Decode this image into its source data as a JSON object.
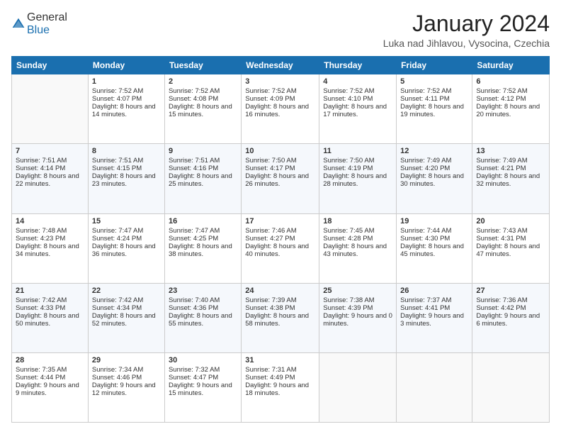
{
  "header": {
    "logo_general": "General",
    "logo_blue": "Blue",
    "month_title": "January 2024",
    "location": "Luka nad Jihlavou, Vysocina, Czechia"
  },
  "weekdays": [
    "Sunday",
    "Monday",
    "Tuesday",
    "Wednesday",
    "Thursday",
    "Friday",
    "Saturday"
  ],
  "weeks": [
    [
      {
        "day": "",
        "sunrise": "",
        "sunset": "",
        "daylight": ""
      },
      {
        "day": "1",
        "sunrise": "Sunrise: 7:52 AM",
        "sunset": "Sunset: 4:07 PM",
        "daylight": "Daylight: 8 hours and 14 minutes."
      },
      {
        "day": "2",
        "sunrise": "Sunrise: 7:52 AM",
        "sunset": "Sunset: 4:08 PM",
        "daylight": "Daylight: 8 hours and 15 minutes."
      },
      {
        "day": "3",
        "sunrise": "Sunrise: 7:52 AM",
        "sunset": "Sunset: 4:09 PM",
        "daylight": "Daylight: 8 hours and 16 minutes."
      },
      {
        "day": "4",
        "sunrise": "Sunrise: 7:52 AM",
        "sunset": "Sunset: 4:10 PM",
        "daylight": "Daylight: 8 hours and 17 minutes."
      },
      {
        "day": "5",
        "sunrise": "Sunrise: 7:52 AM",
        "sunset": "Sunset: 4:11 PM",
        "daylight": "Daylight: 8 hours and 19 minutes."
      },
      {
        "day": "6",
        "sunrise": "Sunrise: 7:52 AM",
        "sunset": "Sunset: 4:12 PM",
        "daylight": "Daylight: 8 hours and 20 minutes."
      }
    ],
    [
      {
        "day": "7",
        "sunrise": "Sunrise: 7:51 AM",
        "sunset": "Sunset: 4:14 PM",
        "daylight": "Daylight: 8 hours and 22 minutes."
      },
      {
        "day": "8",
        "sunrise": "Sunrise: 7:51 AM",
        "sunset": "Sunset: 4:15 PM",
        "daylight": "Daylight: 8 hours and 23 minutes."
      },
      {
        "day": "9",
        "sunrise": "Sunrise: 7:51 AM",
        "sunset": "Sunset: 4:16 PM",
        "daylight": "Daylight: 8 hours and 25 minutes."
      },
      {
        "day": "10",
        "sunrise": "Sunrise: 7:50 AM",
        "sunset": "Sunset: 4:17 PM",
        "daylight": "Daylight: 8 hours and 26 minutes."
      },
      {
        "day": "11",
        "sunrise": "Sunrise: 7:50 AM",
        "sunset": "Sunset: 4:19 PM",
        "daylight": "Daylight: 8 hours and 28 minutes."
      },
      {
        "day": "12",
        "sunrise": "Sunrise: 7:49 AM",
        "sunset": "Sunset: 4:20 PM",
        "daylight": "Daylight: 8 hours and 30 minutes."
      },
      {
        "day": "13",
        "sunrise": "Sunrise: 7:49 AM",
        "sunset": "Sunset: 4:21 PM",
        "daylight": "Daylight: 8 hours and 32 minutes."
      }
    ],
    [
      {
        "day": "14",
        "sunrise": "Sunrise: 7:48 AM",
        "sunset": "Sunset: 4:23 PM",
        "daylight": "Daylight: 8 hours and 34 minutes."
      },
      {
        "day": "15",
        "sunrise": "Sunrise: 7:47 AM",
        "sunset": "Sunset: 4:24 PM",
        "daylight": "Daylight: 8 hours and 36 minutes."
      },
      {
        "day": "16",
        "sunrise": "Sunrise: 7:47 AM",
        "sunset": "Sunset: 4:25 PM",
        "daylight": "Daylight: 8 hours and 38 minutes."
      },
      {
        "day": "17",
        "sunrise": "Sunrise: 7:46 AM",
        "sunset": "Sunset: 4:27 PM",
        "daylight": "Daylight: 8 hours and 40 minutes."
      },
      {
        "day": "18",
        "sunrise": "Sunrise: 7:45 AM",
        "sunset": "Sunset: 4:28 PM",
        "daylight": "Daylight: 8 hours and 43 minutes."
      },
      {
        "day": "19",
        "sunrise": "Sunrise: 7:44 AM",
        "sunset": "Sunset: 4:30 PM",
        "daylight": "Daylight: 8 hours and 45 minutes."
      },
      {
        "day": "20",
        "sunrise": "Sunrise: 7:43 AM",
        "sunset": "Sunset: 4:31 PM",
        "daylight": "Daylight: 8 hours and 47 minutes."
      }
    ],
    [
      {
        "day": "21",
        "sunrise": "Sunrise: 7:42 AM",
        "sunset": "Sunset: 4:33 PM",
        "daylight": "Daylight: 8 hours and 50 minutes."
      },
      {
        "day": "22",
        "sunrise": "Sunrise: 7:42 AM",
        "sunset": "Sunset: 4:34 PM",
        "daylight": "Daylight: 8 hours and 52 minutes."
      },
      {
        "day": "23",
        "sunrise": "Sunrise: 7:40 AM",
        "sunset": "Sunset: 4:36 PM",
        "daylight": "Daylight: 8 hours and 55 minutes."
      },
      {
        "day": "24",
        "sunrise": "Sunrise: 7:39 AM",
        "sunset": "Sunset: 4:38 PM",
        "daylight": "Daylight: 8 hours and 58 minutes."
      },
      {
        "day": "25",
        "sunrise": "Sunrise: 7:38 AM",
        "sunset": "Sunset: 4:39 PM",
        "daylight": "Daylight: 9 hours and 0 minutes."
      },
      {
        "day": "26",
        "sunrise": "Sunrise: 7:37 AM",
        "sunset": "Sunset: 4:41 PM",
        "daylight": "Daylight: 9 hours and 3 minutes."
      },
      {
        "day": "27",
        "sunrise": "Sunrise: 7:36 AM",
        "sunset": "Sunset: 4:42 PM",
        "daylight": "Daylight: 9 hours and 6 minutes."
      }
    ],
    [
      {
        "day": "28",
        "sunrise": "Sunrise: 7:35 AM",
        "sunset": "Sunset: 4:44 PM",
        "daylight": "Daylight: 9 hours and 9 minutes."
      },
      {
        "day": "29",
        "sunrise": "Sunrise: 7:34 AM",
        "sunset": "Sunset: 4:46 PM",
        "daylight": "Daylight: 9 hours and 12 minutes."
      },
      {
        "day": "30",
        "sunrise": "Sunrise: 7:32 AM",
        "sunset": "Sunset: 4:47 PM",
        "daylight": "Daylight: 9 hours and 15 minutes."
      },
      {
        "day": "31",
        "sunrise": "Sunrise: 7:31 AM",
        "sunset": "Sunset: 4:49 PM",
        "daylight": "Daylight: 9 hours and 18 minutes."
      },
      {
        "day": "",
        "sunrise": "",
        "sunset": "",
        "daylight": ""
      },
      {
        "day": "",
        "sunrise": "",
        "sunset": "",
        "daylight": ""
      },
      {
        "day": "",
        "sunrise": "",
        "sunset": "",
        "daylight": ""
      }
    ]
  ]
}
